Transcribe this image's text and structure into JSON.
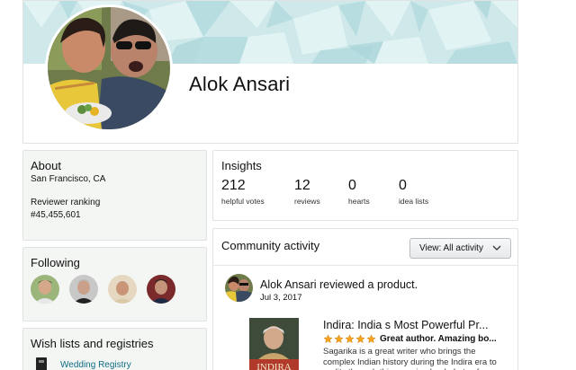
{
  "profile": {
    "name": "Alok Ansari"
  },
  "about": {
    "title": "About",
    "location": "San Francisco, CA",
    "ranking_label": "Reviewer ranking",
    "ranking_value": "#45,455,601"
  },
  "following": {
    "title": "Following",
    "avatars": [
      "person-1",
      "person-2",
      "person-3",
      "person-4"
    ]
  },
  "wishlists": {
    "title": "Wish lists and registries",
    "items": [
      {
        "label": "Wedding Registry",
        "icon": "registry-icon"
      }
    ]
  },
  "insights": {
    "title": "Insights",
    "stats": [
      {
        "value": "212",
        "label": "helpful votes"
      },
      {
        "value": "12",
        "label": "reviews"
      },
      {
        "value": "0",
        "label": "hearts"
      },
      {
        "value": "0",
        "label": "idea lists"
      }
    ]
  },
  "community": {
    "title": "Community activity",
    "view_button": "View: All activity",
    "activity": {
      "actor": "Alok Ansari",
      "action": "reviewed a product.",
      "date": "Jul 3, 2017",
      "product_title": "Indira: India s Most Powerful Pr...",
      "rating": 5,
      "review_headline": "Great author. Amazing bo...",
      "review_body": "Sagarika is a great writer who brings the complex Indian history during the Indira era to reality through this amazing book. Lots of",
      "cover_text": "INDIRA"
    }
  },
  "colors": {
    "link": "#0f6c84",
    "star": "#f4a41d",
    "banner": "#cfe8ea",
    "panel_gray": "#f4f6f4"
  }
}
